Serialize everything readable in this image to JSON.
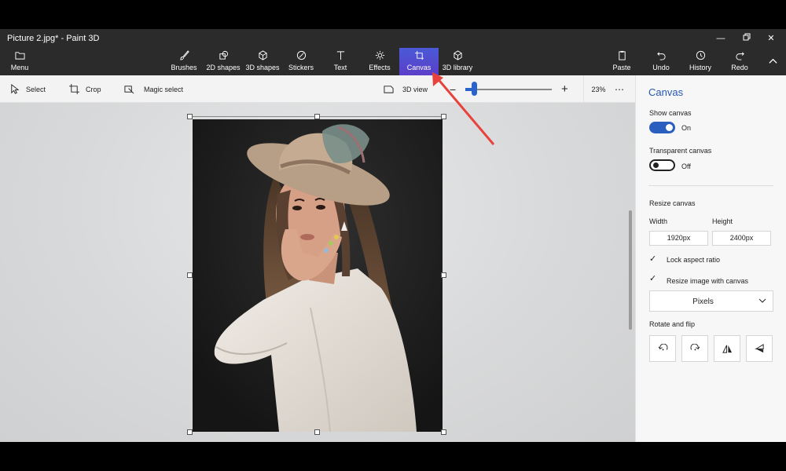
{
  "window": {
    "title": "Picture 2.jpg* - Paint 3D",
    "controls": [
      "minimize",
      "restore",
      "close"
    ]
  },
  "ribbon": {
    "menu_label": "Menu",
    "tools": [
      {
        "label": "Brushes",
        "icon": "brush-icon"
      },
      {
        "label": "2D shapes",
        "icon": "2d-shapes-icon"
      },
      {
        "label": "3D shapes",
        "icon": "3d-shapes-icon"
      },
      {
        "label": "Stickers",
        "icon": "stickers-icon"
      },
      {
        "label": "Text",
        "icon": "text-icon"
      },
      {
        "label": "Effects",
        "icon": "effects-icon"
      },
      {
        "label": "Canvas",
        "icon": "canvas-icon",
        "active": true
      },
      {
        "label": "3D library",
        "icon": "3d-library-icon"
      }
    ],
    "right_tools": [
      {
        "label": "Paste",
        "icon": "paste-icon"
      },
      {
        "label": "Undo",
        "icon": "undo-icon"
      },
      {
        "label": "History",
        "icon": "history-icon"
      },
      {
        "label": "Redo",
        "icon": "redo-icon"
      }
    ],
    "accent_color": "#4a5ad6"
  },
  "subbar": {
    "select_label": "Select",
    "crop_label": "Crop",
    "magic_select_label": "Magic select",
    "view3d_label": "3D view",
    "zoom_percent": "23%",
    "zoom_level": 0.1,
    "more_label": "⋯"
  },
  "panel": {
    "title": "Canvas",
    "show_canvas": {
      "label": "Show canvas",
      "state": "On",
      "on": true
    },
    "transparent_canvas": {
      "label": "Transparent canvas",
      "state": "Off",
      "on": false
    },
    "resize_heading": "Resize canvas",
    "width_label": "Width",
    "height_label": "Height",
    "width_value": "1920px",
    "height_value": "2400px",
    "lock_aspect": {
      "label": "Lock aspect ratio",
      "checked": true
    },
    "resize_with_canvas": {
      "label": "Resize image with canvas",
      "checked": true
    },
    "units": {
      "selected": "Pixels"
    },
    "rotate_heading": "Rotate and flip",
    "rotate_buttons": [
      "rotate-left-icon",
      "rotate-right-icon",
      "flip-vertical-icon",
      "flip-horizontal-icon"
    ],
    "accent_color": "#2a5fbf"
  },
  "annotation": {
    "color": "#e8423c"
  }
}
